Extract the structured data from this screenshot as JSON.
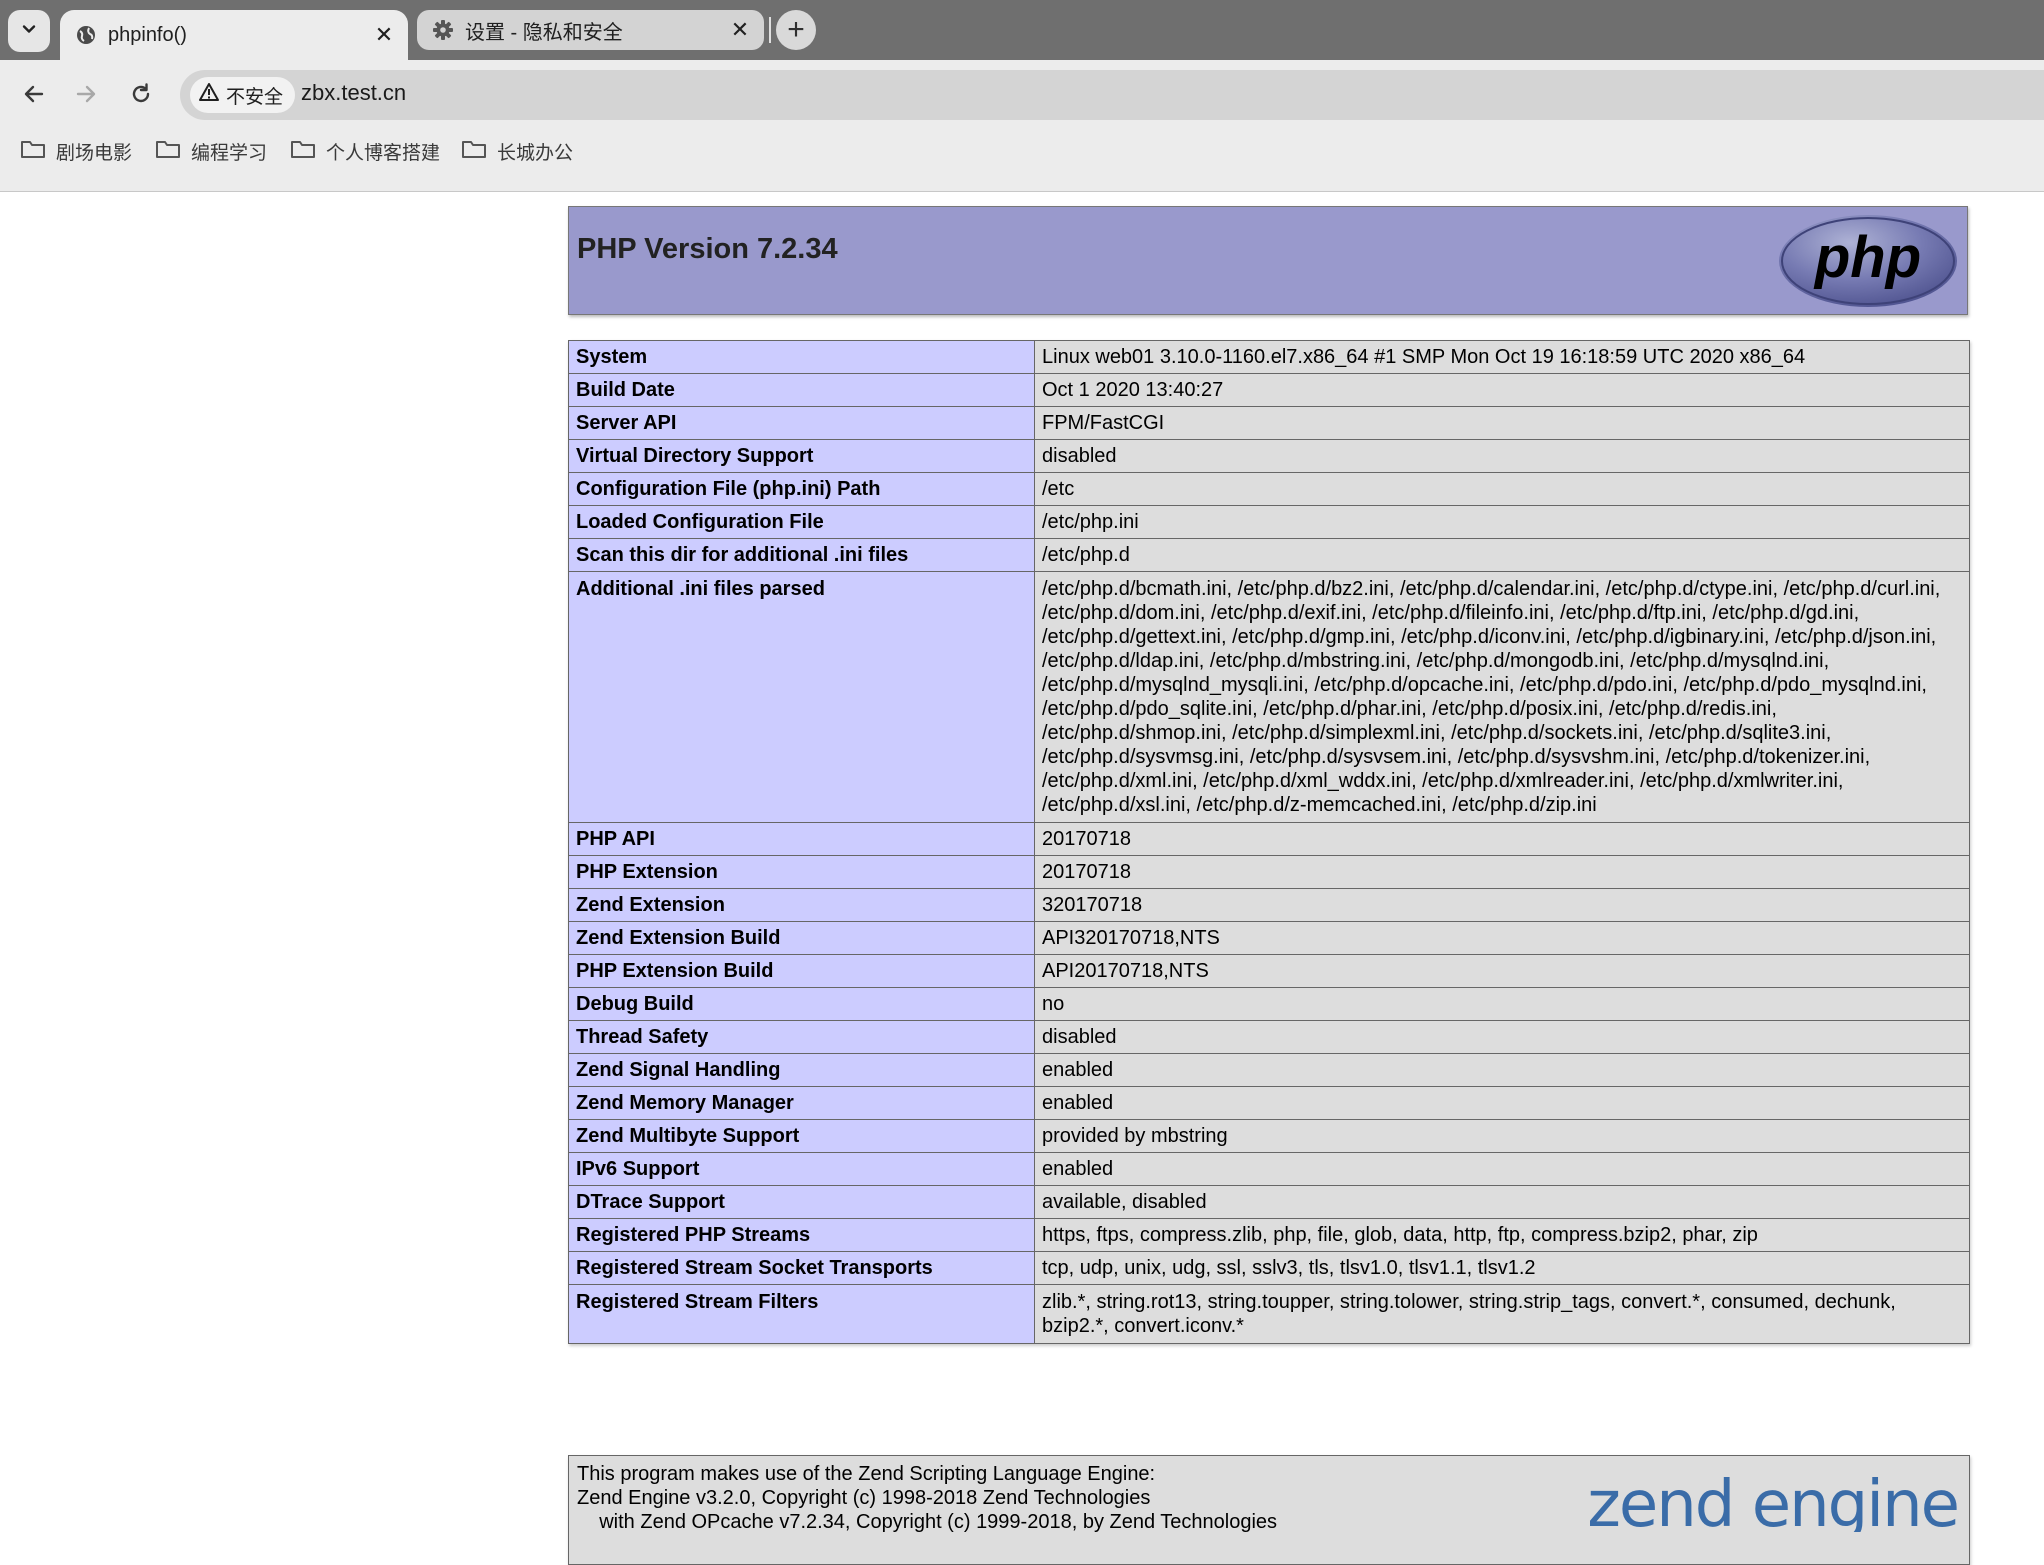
{
  "browser": {
    "tabs": [
      {
        "label": "phpinfo()",
        "icon": "globe-icon",
        "active": true
      },
      {
        "label": "设置 - 隐私和安全",
        "icon": "gear-icon",
        "active": false
      }
    ],
    "close_glyph": "✕",
    "new_tab_glyph": "+",
    "security_label": "不安全",
    "url": "zbx.test.cn",
    "bookmarks": [
      "剧场电影",
      "编程学习",
      "个人博客搭建",
      "长城办公"
    ]
  },
  "php": {
    "title": "PHP Version 7.2.34",
    "logo_text": "php",
    "rows": [
      {
        "label": "System",
        "value": "Linux web01 3.10.0-1160.el7.x86_64 #1 SMP Mon Oct 19 16:18:59 UTC 2020 x86_64"
      },
      {
        "label": "Build Date",
        "value": "Oct 1 2020 13:40:27"
      },
      {
        "label": "Server API",
        "value": "FPM/FastCGI"
      },
      {
        "label": "Virtual Directory Support",
        "value": "disabled"
      },
      {
        "label": "Configuration File (php.ini) Path",
        "value": "/etc"
      },
      {
        "label": "Loaded Configuration File",
        "value": "/etc/php.ini"
      },
      {
        "label": "Scan this dir for additional .ini files",
        "value": "/etc/php.d"
      },
      {
        "label": "Additional .ini files parsed",
        "value": "/etc/php.d/bcmath.ini, /etc/php.d/bz2.ini, /etc/php.d/calendar.ini, /etc/php.d/ctype.ini, /etc/php.d/curl.ini, /etc/php.d/dom.ini, /etc/php.d/exif.ini, /etc/php.d/fileinfo.ini, /etc/php.d/ftp.ini, /etc/php.d/gd.ini, /etc/php.d/gettext.ini, /etc/php.d/gmp.ini, /etc/php.d/iconv.ini, /etc/php.d/igbinary.ini, /etc/php.d/json.ini, /etc/php.d/ldap.ini, /etc/php.d/mbstring.ini, /etc/php.d/mongodb.ini, /etc/php.d/mysqlnd.ini, /etc/php.d/mysqlnd_mysqli.ini, /etc/php.d/opcache.ini, /etc/php.d/pdo.ini, /etc/php.d/pdo_mysqlnd.ini, /etc/php.d/pdo_sqlite.ini, /etc/php.d/phar.ini, /etc/php.d/posix.ini, /etc/php.d/redis.ini, /etc/php.d/shmop.ini, /etc/php.d/simplexml.ini, /etc/php.d/sockets.ini, /etc/php.d/sqlite3.ini, /etc/php.d/sysvmsg.ini, /etc/php.d/sysvsem.ini, /etc/php.d/sysvshm.ini, /etc/php.d/tokenizer.ini, /etc/php.d/xml.ini, /etc/php.d/xml_wddx.ini, /etc/php.d/xmlreader.ini, /etc/php.d/xmlwriter.ini, /etc/php.d/xsl.ini, /etc/php.d/z-memcached.ini, /etc/php.d/zip.ini"
      },
      {
        "label": "PHP API",
        "value": "20170718"
      },
      {
        "label": "PHP Extension",
        "value": "20170718"
      },
      {
        "label": "Zend Extension",
        "value": "320170718"
      },
      {
        "label": "Zend Extension Build",
        "value": "API320170718,NTS"
      },
      {
        "label": "PHP Extension Build",
        "value": "API20170718,NTS"
      },
      {
        "label": "Debug Build",
        "value": "no"
      },
      {
        "label": "Thread Safety",
        "value": "disabled"
      },
      {
        "label": "Zend Signal Handling",
        "value": "enabled"
      },
      {
        "label": "Zend Memory Manager",
        "value": "enabled"
      },
      {
        "label": "Zend Multibyte Support",
        "value": "provided by mbstring"
      },
      {
        "label": "IPv6 Support",
        "value": "enabled"
      },
      {
        "label": "DTrace Support",
        "value": "available, disabled"
      },
      {
        "label": "Registered PHP Streams",
        "value": "https, ftps, compress.zlib, php, file, glob, data, http, ftp, compress.bzip2, phar, zip"
      },
      {
        "label": "Registered Stream Socket Transports",
        "value": "tcp, udp, unix, udg, ssl, sslv3, tls, tlsv1.0, tlsv1.1, tlsv1.2"
      },
      {
        "label": "Registered Stream Filters",
        "value": "zlib.*, string.rot13, string.toupper, string.tolower, string.strip_tags, convert.*, consumed, dechunk, bzip2.*, convert.iconv.*"
      }
    ],
    "zend_text": "This program makes use of the Zend Scripting Language Engine:\nZend Engine v3.2.0, Copyright (c) 1998-2018 Zend Technologies\n    with Zend OPcache v7.2.34, Copyright (c) 1999-2018, by Zend Technologies",
    "zend_logo_text": "zend engine"
  },
  "colors": {
    "php_header": "#9999cc",
    "label_cell": "#ccccff",
    "value_cell": "#dddddd",
    "zend_logo": "#3a6ca8"
  }
}
